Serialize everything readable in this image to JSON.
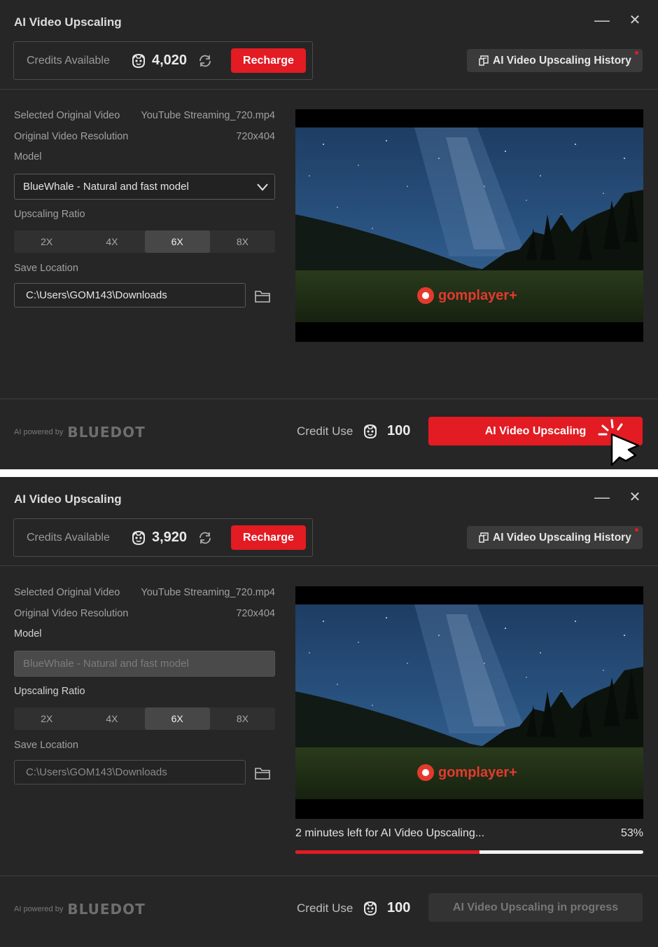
{
  "window": {
    "title": "AI Video Upscaling",
    "minimize_glyph": "—",
    "close_glyph": "✕"
  },
  "icons": {
    "coin": "coin-face-icon",
    "refresh": "refresh-icon",
    "history": "history-document-icon",
    "folder": "folder-icon",
    "chevron": "chevron-down-icon",
    "cursor": "mouse-pointer-click-icon"
  },
  "colors": {
    "accent": "#e31b23",
    "background": "#262626"
  },
  "labels": {
    "credits_available": "Credits Available",
    "recharge": "Recharge",
    "history": "AI Video Upscaling History",
    "selected_video": "Selected Original Video",
    "original_resolution": "Original Video Resolution",
    "model": "Model",
    "upscaling_ratio": "Upscaling Ratio",
    "save_location": "Save Location",
    "powered_by": "AI powered by",
    "brand": "BLUEDOT",
    "credit_use": "Credit Use"
  },
  "video": {
    "filename": "YouTube Streaming_720.mp4",
    "resolution": "720x404",
    "watermark": "gomplayer+"
  },
  "model_value": "BlueWhale - Natural and fast model",
  "ratio_options": [
    "2X",
    "4X",
    "6X",
    "8X"
  ],
  "ratio_selected": "6X",
  "save_path": "C:\\Users\\GOM143\\Downloads",
  "credit_use_value": "100",
  "state_before": {
    "credits": "4,020",
    "action_label": "AI Video Upscaling"
  },
  "state_during": {
    "credits": "3,920",
    "progress_text": "2 minutes left for AI Video Upscaling...",
    "progress_percent_label": "53%",
    "progress_fraction": 0.53,
    "action_label": "AI Video Upscaling in progress"
  }
}
